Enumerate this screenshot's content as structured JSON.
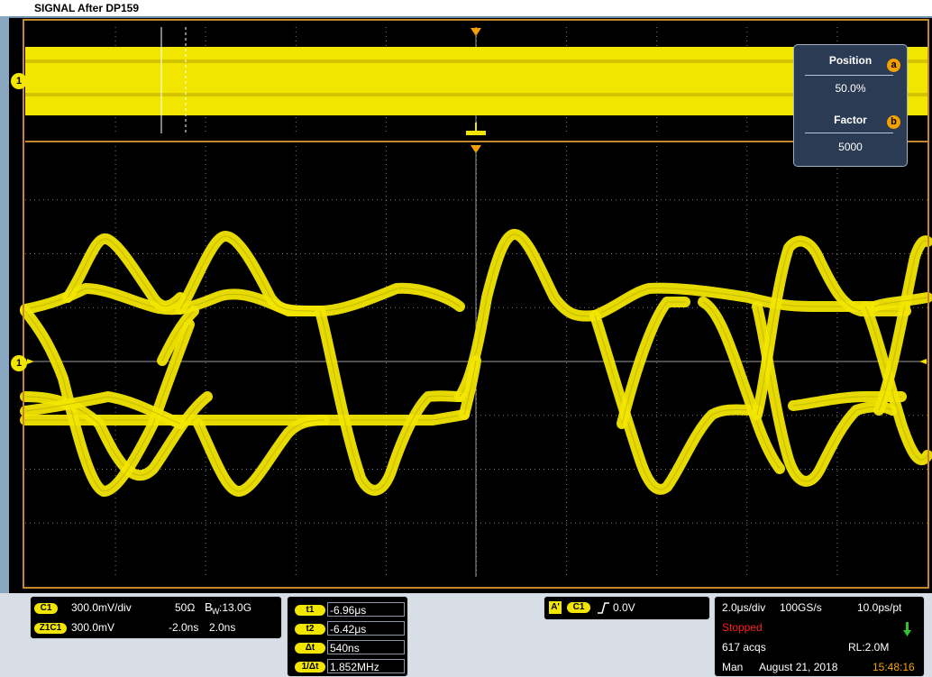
{
  "window": {
    "title": "SIGNAL After DP159"
  },
  "channel_marker_label": "1",
  "zoom_menu": {
    "position_label": "Position",
    "position_value": "50.0%",
    "position_key": "a",
    "factor_label": "Factor",
    "factor_value": "5000",
    "factor_key": "b"
  },
  "vertical_panel": {
    "channel_badge": "C1",
    "scale": "300.0mV/div",
    "impedance": "50Ω",
    "bandwidth_label": "B",
    "bandwidth_sub": "W",
    "bandwidth": ":13.0G",
    "zoom_badge": "Z1C1",
    "zoom_scale": "300.0mV",
    "zoom_pos1": "-2.0ns",
    "zoom_pos2": "2.0ns"
  },
  "cursor_panel": {
    "rows": [
      {
        "label": "t1",
        "value": "-6.96μs"
      },
      {
        "label": "t2",
        "value": "-6.42μs"
      },
      {
        "label": "Δt",
        "value": "540ns"
      },
      {
        "label": "1/Δt",
        "value": "1.852MHz"
      }
    ]
  },
  "trigger_panel": {
    "mode_badge": "A'",
    "source_badge": "C1",
    "slope_icon": "rising-edge-icon",
    "level": "0.0V"
  },
  "acquisition_panel": {
    "horizontal_scale": "2.0μs/div",
    "sample_rate": "100GS/s",
    "resolution": "10.0ps/pt",
    "state": "Stopped",
    "acqs": "617 acqs",
    "record_length": "RL:2.0M",
    "trigger_mode": "Man",
    "date": "August 21, 2018",
    "time": "15:48:16"
  },
  "colors": {
    "trace": "#f2e600",
    "frame": "#c8862a",
    "stopped": "#ff2020",
    "time": "#f4a100"
  }
}
